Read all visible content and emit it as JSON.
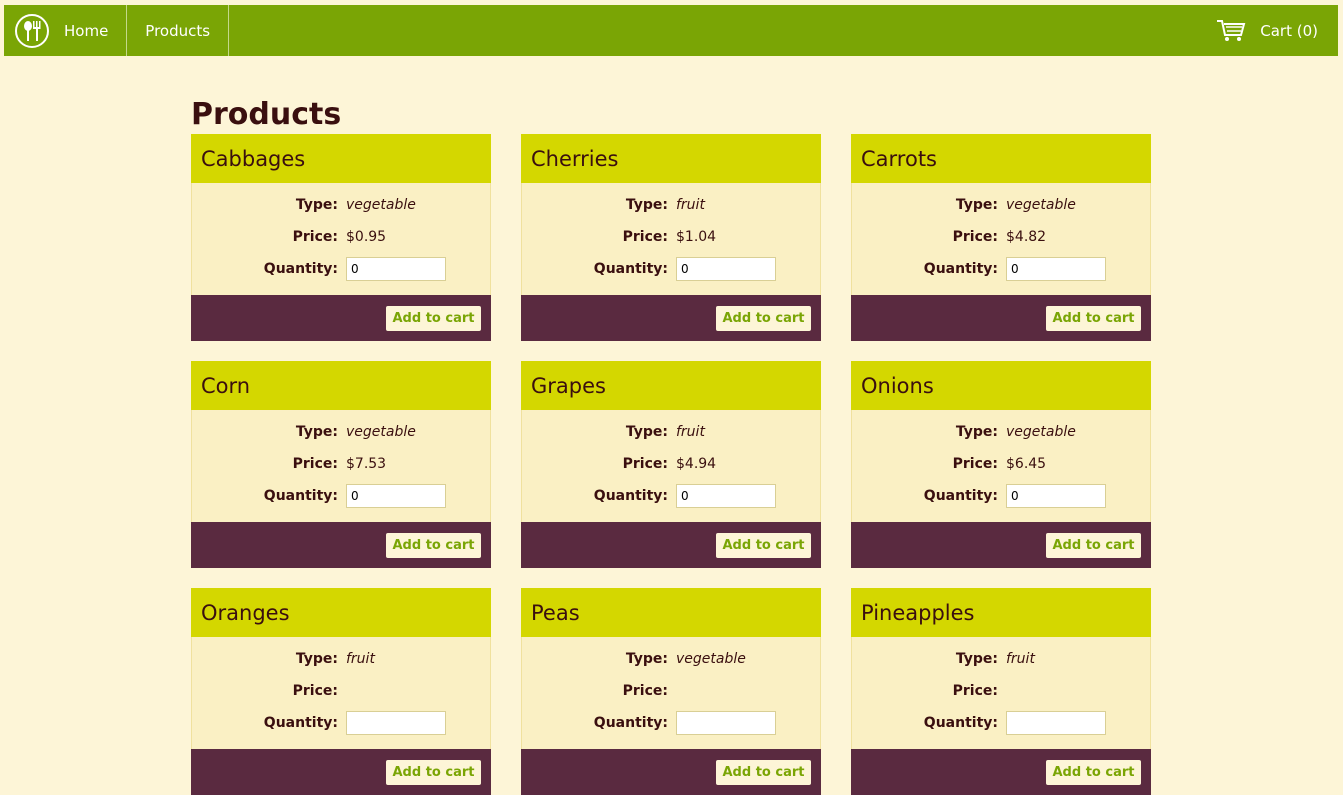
{
  "nav": {
    "home_label": "Home",
    "products_label": "Products",
    "cart_label": "Cart (0)",
    "accent_color": "#7aa505"
  },
  "page": {
    "title": "Products"
  },
  "labels": {
    "type": "Type:",
    "price": "Price:",
    "quantity": "Quantity:",
    "add_to_cart": "Add to cart"
  },
  "products": [
    {
      "name": "Cabbages",
      "type": "vegetable",
      "price": "$0.95",
      "quantity": "0"
    },
    {
      "name": "Cherries",
      "type": "fruit",
      "price": "$1.04",
      "quantity": "0"
    },
    {
      "name": "Carrots",
      "type": "vegetable",
      "price": "$4.82",
      "quantity": "0"
    },
    {
      "name": "Corn",
      "type": "vegetable",
      "price": "$7.53",
      "quantity": "0"
    },
    {
      "name": "Grapes",
      "type": "fruit",
      "price": "$4.94",
      "quantity": "0"
    },
    {
      "name": "Onions",
      "type": "vegetable",
      "price": "$6.45",
      "quantity": "0"
    },
    {
      "name": "Oranges",
      "type": "fruit"
    },
    {
      "name": "Peas",
      "type": "vegetable"
    },
    {
      "name": "Pineapples",
      "type": "fruit"
    }
  ]
}
